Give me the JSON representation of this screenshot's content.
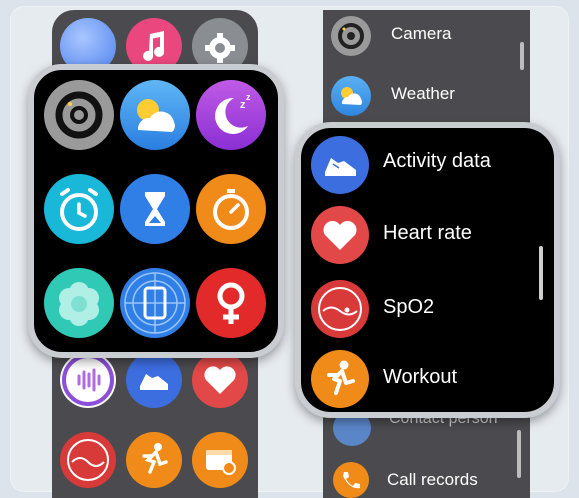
{
  "right_list_top": [
    {
      "label": "Camera",
      "icon": "camera-icon"
    },
    {
      "label": "Weather",
      "icon": "weather-icon"
    }
  ],
  "right_list_bottom": [
    {
      "label": "Contact person",
      "icon": "contact-person-icon"
    },
    {
      "label": "Call records",
      "icon": "call-records-icon"
    }
  ],
  "watch_menu": [
    {
      "label": "Activity data",
      "icon": "shoe-icon",
      "color": "#3d6ee0"
    },
    {
      "label": "Heart rate",
      "icon": "heart-icon",
      "color": "#e24848"
    },
    {
      "label": "SpO2",
      "icon": "spo2-icon",
      "color": "#d83a3a"
    },
    {
      "label": "Workout",
      "icon": "running-icon",
      "color": "#f08a18"
    }
  ],
  "watch_grid_icons": [
    "camera-icon",
    "weather-icon",
    "sleep-icon",
    "alarm-icon",
    "timer-icon",
    "stopwatch-icon",
    "breathe-icon",
    "compass-icon",
    "female-health-icon"
  ]
}
